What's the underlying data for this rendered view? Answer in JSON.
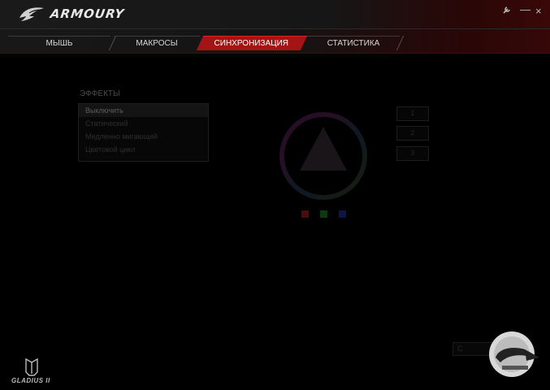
{
  "app": {
    "brand": "ARMOURY"
  },
  "window": {
    "settings_icon": "wrench-icon",
    "minimize_label": "—",
    "close_label": "×"
  },
  "tabs": [
    {
      "label": "МЫШЬ",
      "active": false
    },
    {
      "label": "МАКРОСЫ",
      "active": false
    },
    {
      "label": "СИНХРОНИЗАЦИЯ",
      "active": true
    },
    {
      "label": "СТАТИСТИКА",
      "active": false
    }
  ],
  "effects": {
    "title": "ЭФФЕКТЫ",
    "items": [
      {
        "label": "Выключить",
        "selected": true
      },
      {
        "label": "Статический",
        "selected": false
      },
      {
        "label": "Медленно мигающий",
        "selected": false
      },
      {
        "label": "Цветовой цикл",
        "selected": false
      }
    ]
  },
  "side_buttons": [
    "1",
    "2",
    "3"
  ],
  "swatches": [
    {
      "name": "red",
      "color": "#4a0c0c"
    },
    {
      "name": "green",
      "color": "#0c3a10"
    },
    {
      "name": "blue",
      "color": "#0c1448"
    }
  ],
  "apply_button": {
    "label": "С"
  },
  "device": {
    "name": "GLADIUS II"
  },
  "colors": {
    "accent": "#a31414",
    "background": "#000000"
  }
}
